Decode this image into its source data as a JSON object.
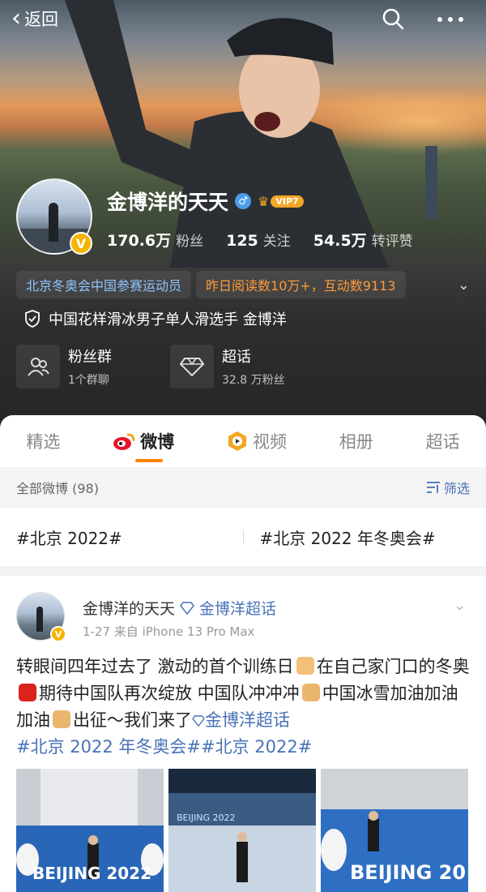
{
  "topbar": {
    "back_label": "返回"
  },
  "profile": {
    "name": "金博洋的天天",
    "gender_icon": "male-icon",
    "vip_label": "VIP7",
    "verified_badge": "V",
    "stats": [
      {
        "num": "170.6万",
        "label": "粉丝"
      },
      {
        "num": "125",
        "label": "关注"
      },
      {
        "num": "54.5万",
        "label": "转评赞"
      }
    ],
    "tags": [
      {
        "text": "北京冬奥会中国参赛运动员",
        "color": "#8ec4ff"
      },
      {
        "text": "昨日阅读数10万+，互动数9113",
        "color": "#ff9a3a"
      }
    ],
    "verification": "中国花样滑冰男子单人滑选手 金博洋",
    "groups": [
      {
        "title": "粉丝群",
        "sub": "1个群聊",
        "icon": "people-icon"
      },
      {
        "title": "超话",
        "sub": "32.8 万粉丝",
        "icon": "diamond-icon"
      }
    ]
  },
  "tabs": [
    {
      "label": "精选",
      "active": false
    },
    {
      "label": "微博",
      "active": true,
      "icon": "weibo-icon"
    },
    {
      "label": "视频",
      "active": false,
      "icon": "video-icon"
    },
    {
      "label": "相册",
      "active": false
    },
    {
      "label": "超话",
      "active": false
    }
  ],
  "filter": {
    "label": "全部微博 (98)",
    "button": "筛选"
  },
  "topics": [
    "#北京 2022#",
    "#北京 2022 年冬奥会#"
  ],
  "post": {
    "author": "金博洋的天天",
    "super_topic": "金博洋超话",
    "meta": "1-27  来自 iPhone 13 Pro Max",
    "text": {
      "p1": "转眼间四年过去了 激动的首个训练日",
      "p2": "在自己家门口的冬奥",
      "p3": "期待中国队再次绽放  中国队冲冲冲",
      "p4": "中国冰雪加油加油加油",
      "p5": "出征～我们来了",
      "link1": "金博洋超话",
      "link2": "#北京 2022 年冬奥会##北京 2022#"
    },
    "image_texts": [
      "BEIJING 2022",
      "BEIJING 2022",
      "BEIJING 20"
    ]
  },
  "colors": {
    "accent": "#ff8200",
    "link": "#4872b8",
    "vip": "#f5a623"
  }
}
